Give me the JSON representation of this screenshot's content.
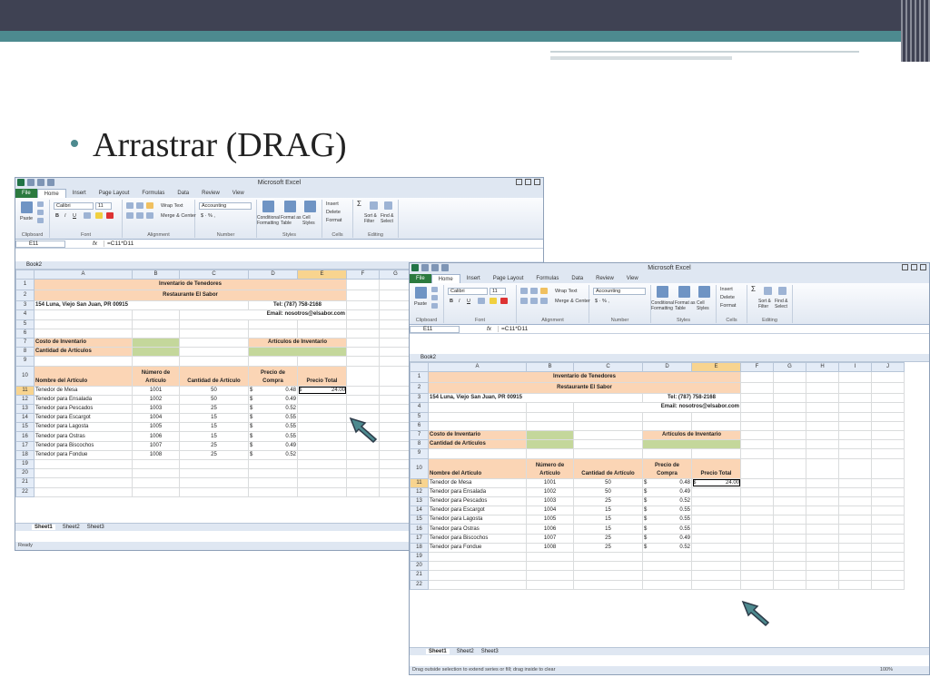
{
  "slide": {
    "title": "Arrastrar (DRAG)"
  },
  "colors": {
    "band_dark": "#3f4253",
    "band_teal": "#4d8a8f",
    "peach": "#fbd5b5",
    "green": "#c4d79b",
    "selected_header": "#f8d48f"
  },
  "window1": {
    "app_title": "Microsoft Excel",
    "workbook": "Book2",
    "tabs": [
      "File",
      "Home",
      "Insert",
      "Page Layout",
      "Formulas",
      "Data",
      "Review",
      "View"
    ],
    "ribbon": {
      "font_name": "Calibri",
      "font_size": "11",
      "wrap_text": "Wrap Text",
      "merge_center": "Merge & Center",
      "number_format": "Accounting",
      "conditional": "Conditional Formatting",
      "format_table": "Format as Table",
      "cell_styles": "Cell Styles",
      "insert": "Insert",
      "delete": "Delete",
      "format": "Format",
      "sort_filter": "Sort & Filter",
      "find_select": "Find & Select",
      "paste": "Paste",
      "groups": [
        "Clipboard",
        "Font",
        "Alignment",
        "Number",
        "Styles",
        "Cells",
        "Editing"
      ]
    },
    "name_box": "E11",
    "fx": "fx",
    "formula": "=C11*D11",
    "sheet_tabs": [
      "Sheet1",
      "Sheet2",
      "Sheet3"
    ],
    "status": "Ready",
    "columns": [
      "A",
      "B",
      "C",
      "D",
      "E",
      "F",
      "G"
    ],
    "selected_column": "E"
  },
  "window2": {
    "app_title": "Microsoft Excel",
    "workbook": "Book2",
    "name_box": "E11",
    "formula": "=C11*D11",
    "sheet_tabs": [
      "Sheet1",
      "Sheet2",
      "Sheet3"
    ],
    "status": "Drag outside selection to extend series or fill; drag inside to clear",
    "zoom": "100%",
    "columns": [
      "A",
      "B",
      "C",
      "D",
      "E",
      "F",
      "G",
      "H",
      "I",
      "J"
    ],
    "selected_column": "E"
  },
  "sheet": {
    "title1": "Inventario de Tenedores",
    "title2": "Restaurante El Sabor",
    "address": "154 Luna, Viejo San Juan, PR 00915",
    "tel": "Tel: (787) 758-2168",
    "email": "Email: nosotros@elsabor.com",
    "costo": "Costo de Inventario",
    "cantidad": "Cantidad de Artículos",
    "articulos_inv": "Artículos de Inventario",
    "headers": {
      "nombre": "Nombre del Artículo",
      "numero": "Número de Artículo",
      "cantidad": "Cantidad de Artículo",
      "precio": "Precio de Compra",
      "total": "Precio Total"
    },
    "items": [
      {
        "row": "11",
        "name": "Tenedor de Mesa",
        "num": "1001",
        "qty": "50",
        "cur": "$",
        "price": "0.48"
      },
      {
        "row": "12",
        "name": "Tenedor para Ensalada",
        "num": "1002",
        "qty": "50",
        "cur": "$",
        "price": "0.49"
      },
      {
        "row": "13",
        "name": "Tenedor para Pescados",
        "num": "1003",
        "qty": "25",
        "cur": "$",
        "price": "0.52"
      },
      {
        "row": "14",
        "name": "Tenedor para Escargot",
        "num": "1004",
        "qty": "15",
        "cur": "$",
        "price": "0.55"
      },
      {
        "row": "15",
        "name": "Tenedor para Lagosta",
        "num": "1005",
        "qty": "15",
        "cur": "$",
        "price": "0.55"
      },
      {
        "row": "16",
        "name": "Tenedor para Ostras",
        "num": "1006",
        "qty": "15",
        "cur": "$",
        "price": "0.55"
      },
      {
        "row": "17",
        "name": "Tenedor para Biscochos",
        "num": "1007",
        "qty": "25",
        "cur": "$",
        "price": "0.49"
      },
      {
        "row": "18",
        "name": "Tenedor para Fondue",
        "num": "1008",
        "qty": "25",
        "cur": "$",
        "price": "0.52"
      }
    ],
    "total_first": {
      "cur": "$",
      "value": "24.00"
    }
  }
}
